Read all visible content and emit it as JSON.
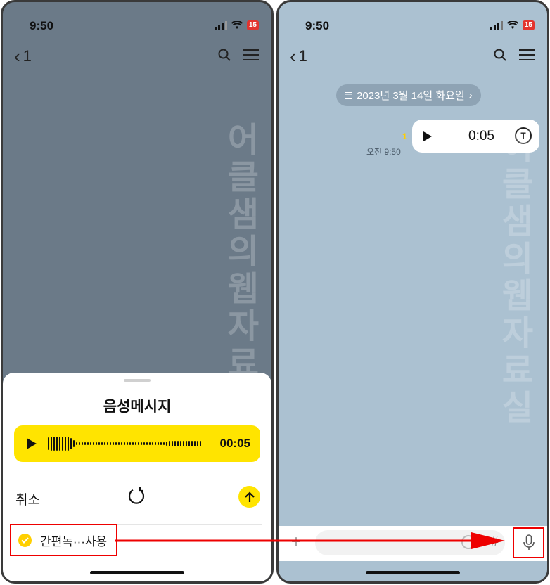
{
  "left_screen": {
    "status_time": "9:50",
    "battery": "15",
    "back_count": "1",
    "sheet": {
      "title": "음성메시지",
      "duration": "00:05",
      "cancel_label": "취소",
      "checkbox_label": "간편녹···사용"
    }
  },
  "right_screen": {
    "status_time": "9:50",
    "battery": "15",
    "back_count": "1",
    "date_label": "2023년 3월 14일 화요일",
    "message": {
      "unread_count": "1",
      "time": "오전 9:50",
      "duration": "0:05",
      "transcribe_icon_label": "T"
    },
    "input_bar": {
      "hash_label": "#"
    }
  },
  "watermark": "어클샘의웹자료실",
  "colors": {
    "left_background": "#6b7a88",
    "right_background": "#abc1d1",
    "accent_yellow": "#ffe400",
    "highlight_red": "#e00000"
  },
  "icons": [
    "search-icon",
    "menu-icon",
    "play-icon",
    "retry-icon",
    "send-arrow-icon",
    "check-icon",
    "transcribe-icon",
    "plus-icon",
    "emoji-icon",
    "mic-icon",
    "calendar-icon"
  ]
}
